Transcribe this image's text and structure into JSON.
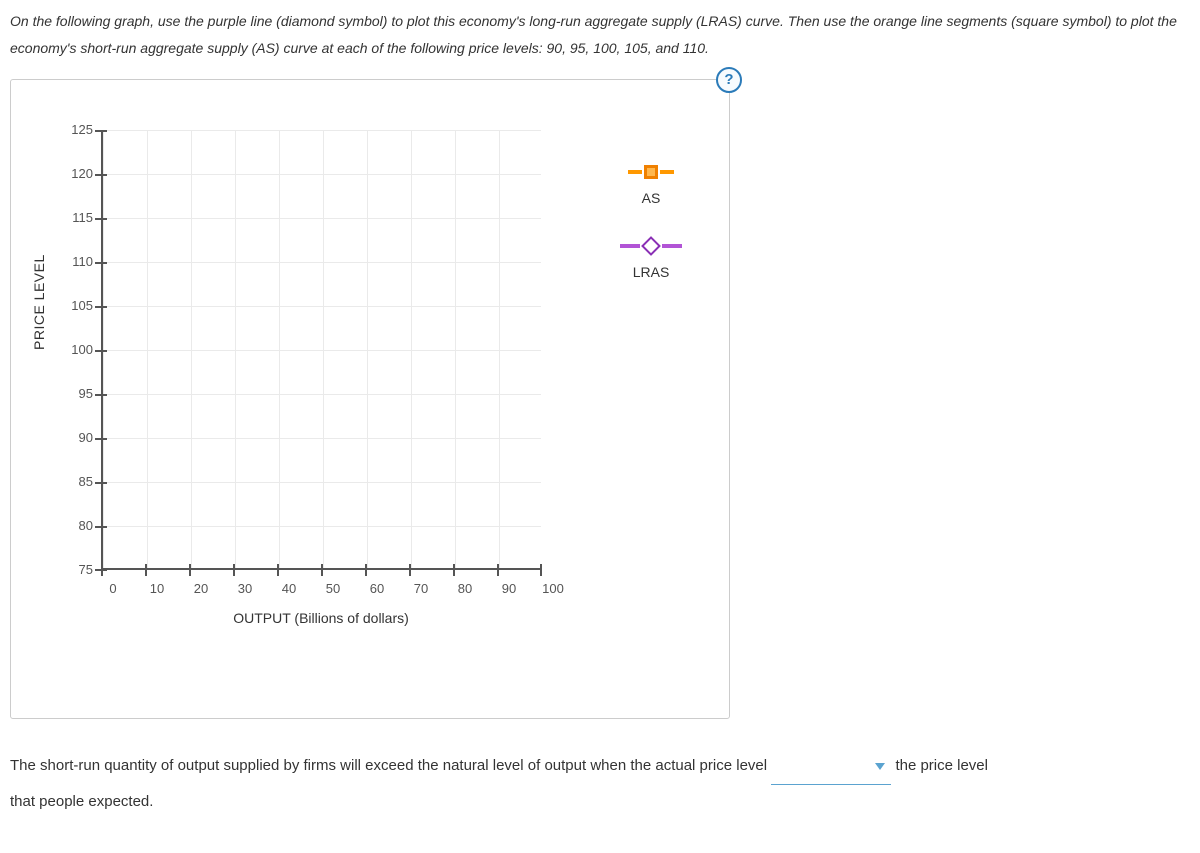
{
  "instructions": "On the following graph, use the purple line (diamond symbol) to plot this economy's long-run aggregate supply (LRAS) curve. Then use the orange line segments (square symbol) to plot the economy's short-run aggregate supply (AS) curve at each of the following price levels: 90, 95, 100, 105, and 110.",
  "help_tooltip": "?",
  "chart_data": {
    "type": "scatter",
    "title": "",
    "xlabel": "OUTPUT (Billions of dollars)",
    "ylabel": "PRICE LEVEL",
    "xlim": [
      0,
      100
    ],
    "ylim": [
      75,
      125
    ],
    "x_ticks": [
      0,
      10,
      20,
      30,
      40,
      50,
      60,
      70,
      80,
      90,
      100
    ],
    "y_ticks": [
      75,
      80,
      85,
      90,
      95,
      100,
      105,
      110,
      115,
      120,
      125
    ],
    "series": [
      {
        "name": "AS",
        "symbol": "square",
        "color": "#ff9800",
        "values": []
      },
      {
        "name": "LRAS",
        "symbol": "diamond",
        "color": "#b254d6",
        "values": []
      }
    ],
    "grid": true,
    "legend_position": "right"
  },
  "legend": {
    "as": "AS",
    "lras": "LRAS"
  },
  "follow_up": {
    "before": "The short-run quantity of output supplied by firms will exceed the natural level of output when the actual price level ",
    "dropdown_value": "",
    "after_dropdown": " the price level",
    "line2": "that people expected."
  }
}
